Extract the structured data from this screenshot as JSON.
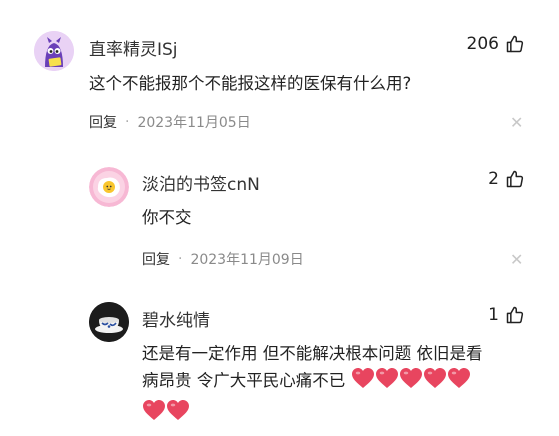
{
  "comments": [
    {
      "username": "直率精灵ISj",
      "likes": "206",
      "text": "这个不能报那个不能报这样的医保有什么用?",
      "reply_label": "回复",
      "date": "2023年11月05日",
      "avatar_icon": "purple-monster-avatar"
    },
    {
      "username": "淡泊的书签cnN",
      "likes": "2",
      "text": "你不交",
      "reply_label": "回复",
      "date": "2023年11月09日",
      "avatar_icon": "fried-egg-avatar"
    },
    {
      "username": "碧水纯情",
      "likes": "1",
      "text_line1": "还是有一定作用 但不能解决根本问题 依旧是看",
      "text_line2": "病昂贵 令广大平民心痛不已",
      "avatar_icon": "porcelain-cup-avatar",
      "heart_emoji_count": 7
    }
  ],
  "colors": {
    "heart": "#e8455f",
    "date": "#8a8a8a"
  }
}
